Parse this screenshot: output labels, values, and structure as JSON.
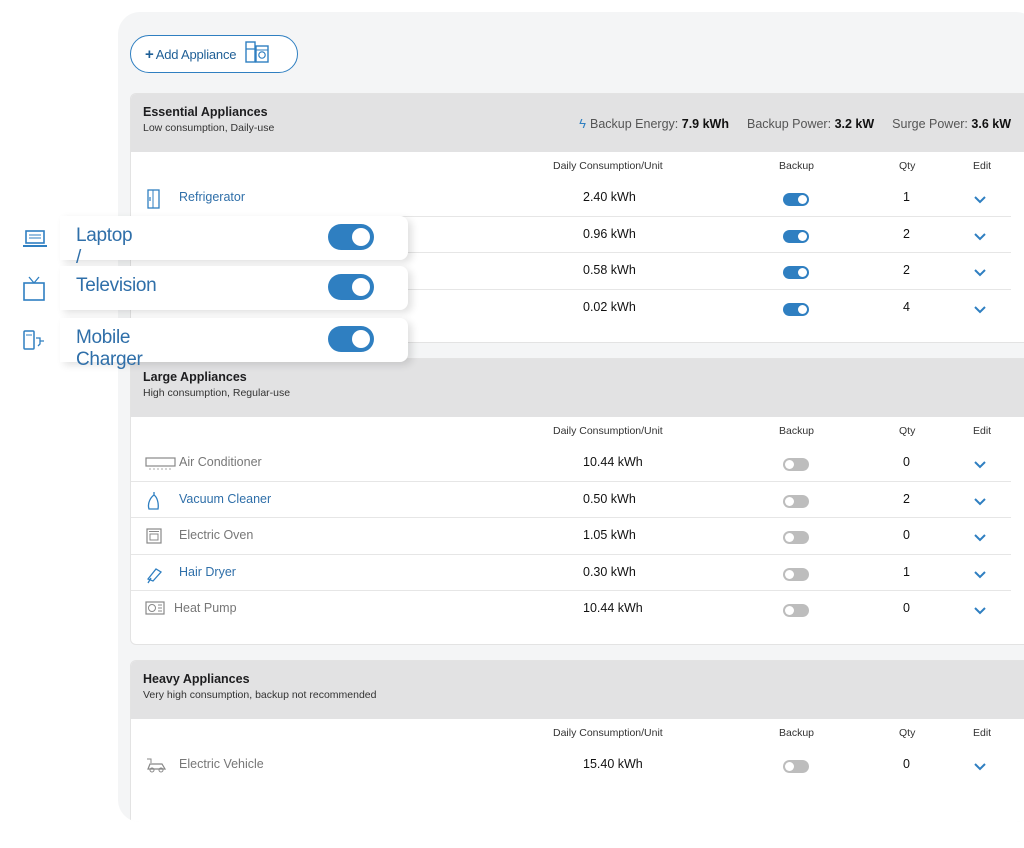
{
  "add_button": {
    "plus": "+",
    "label": "Add Appliance"
  },
  "stats": {
    "backup_energy_label": "Backup Energy:",
    "backup_energy_value": "7.9 kWh",
    "backup_power_label": "Backup Power:",
    "backup_power_value": "3.2 kW",
    "surge_power_label": "Surge Power:",
    "surge_power_value": "3.6 kW"
  },
  "columns": {
    "daily": "Daily Consumption/Unit",
    "backup": "Backup",
    "qty": "Qty",
    "edit": "Edit"
  },
  "sections": [
    {
      "title": "Essential Appliances",
      "subtitle": "Low consumption, Daily-use",
      "rows": [
        {
          "name": "Refrigerator",
          "value": "2.40 kWh",
          "qty": "1",
          "backup": true,
          "icon": "refrigerator-icon"
        },
        {
          "name": "",
          "value": "0.96 kWh",
          "qty": "2",
          "backup": true,
          "icon": "laptop-icon"
        },
        {
          "name": "",
          "value": "0.58 kWh",
          "qty": "2",
          "backup": true,
          "icon": "television-icon"
        },
        {
          "name": "",
          "value": "0.02 kWh",
          "qty": "4",
          "backup": true,
          "icon": "mobile-charger-icon"
        }
      ]
    },
    {
      "title": "Large Appliances",
      "subtitle": "High consumption, Regular-use",
      "rows": [
        {
          "name": "Air Conditioner",
          "value": "10.44 kWh",
          "qty": "0",
          "backup": false,
          "icon": "air-conditioner-icon"
        },
        {
          "name": "Vacuum Cleaner",
          "value": "0.50 kWh",
          "qty": "2",
          "backup": false,
          "icon": "vacuum-cleaner-icon"
        },
        {
          "name": "Electric Oven",
          "value": "1.05 kWh",
          "qty": "0",
          "backup": false,
          "icon": "electric-oven-icon"
        },
        {
          "name": "Hair Dryer",
          "value": "0.30 kWh",
          "qty": "1",
          "backup": false,
          "icon": "hair-dryer-icon"
        },
        {
          "name": "Heat Pump",
          "value": "10.44 kWh",
          "qty": "0",
          "backup": false,
          "icon": "heat-pump-icon"
        }
      ]
    },
    {
      "title": "Heavy Appliances",
      "subtitle": "Very high consumption, backup not recommended",
      "rows": [
        {
          "name": "Electric Vehicle",
          "value": "15.40 kWh",
          "qty": "0",
          "backup": false,
          "icon": "electric-vehicle-icon"
        }
      ]
    }
  ],
  "popouts": [
    {
      "label": "Laptop / Home PC",
      "backup": true,
      "icon": "laptop-icon"
    },
    {
      "label": "Television",
      "backup": true,
      "icon": "television-icon"
    },
    {
      "label": "Mobile Charger",
      "backup": true,
      "icon": "mobile-charger-icon"
    }
  ],
  "colors": {
    "accent": "#2f7fc1",
    "link": "#2f6fa9",
    "section_header": "#e2e2e3"
  }
}
